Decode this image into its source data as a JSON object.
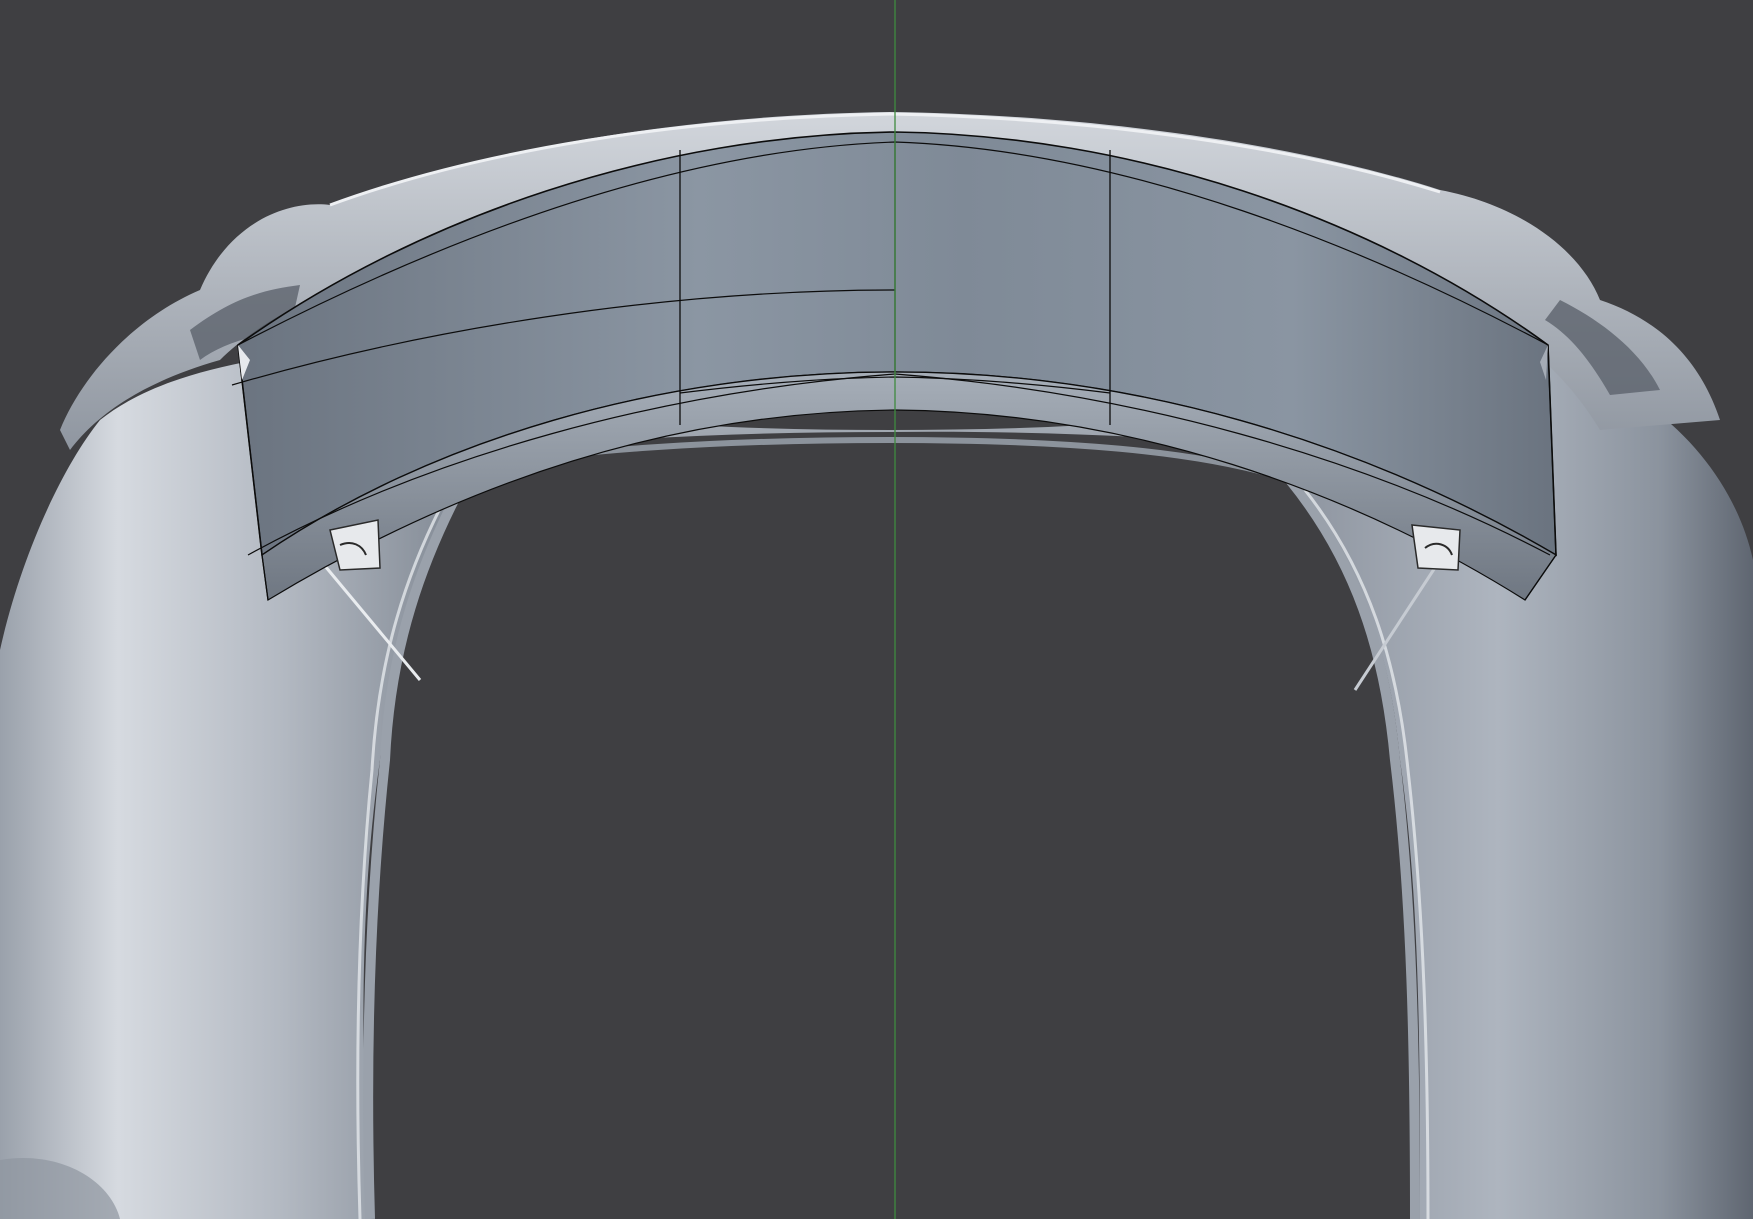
{
  "app": {
    "kind": "3d-modeling-viewport"
  },
  "viewport": {
    "background_color": "#3f3f42",
    "y_axis_line_color": "#3f8a3f",
    "scene_object": "car-body-shell",
    "selected_object": "rear-spoiler-mesh",
    "shading": "solid",
    "wire_color": "#0c0c0c",
    "body_light_color": "#c9ced6",
    "body_shadow_color": "#6c7480",
    "spoiler_light_color": "#8e99a6",
    "spoiler_dark_color": "#5b6470"
  }
}
